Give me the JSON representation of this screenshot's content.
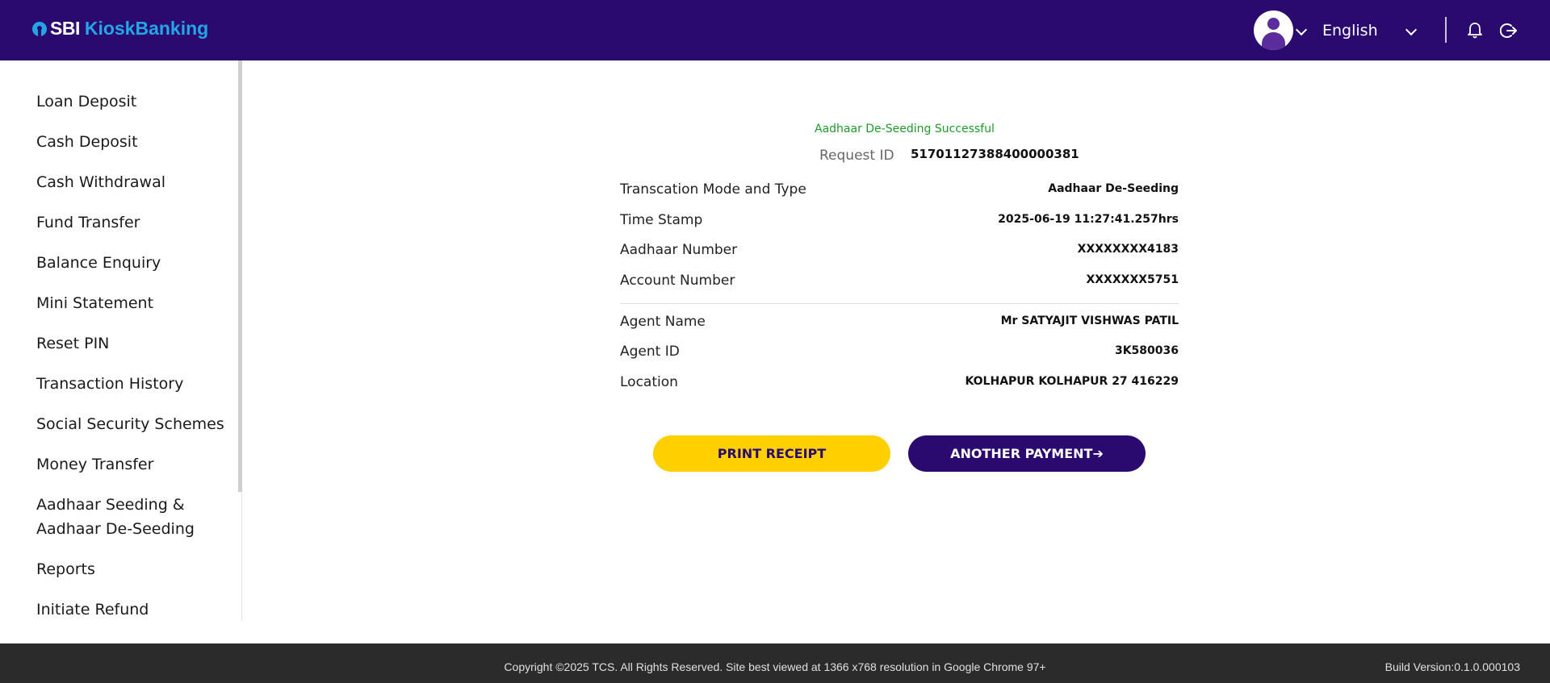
{
  "header": {
    "brand_sbi": "SBI",
    "brand_kiosk": "KioskBanking",
    "language": "English"
  },
  "sidebar": {
    "items": [
      {
        "label": "Loan Deposit"
      },
      {
        "label": "Cash Deposit"
      },
      {
        "label": "Cash Withdrawal"
      },
      {
        "label": "Fund Transfer"
      },
      {
        "label": "Balance Enquiry"
      },
      {
        "label": "Mini Statement"
      },
      {
        "label": "Reset PIN"
      },
      {
        "label": "Transaction History"
      },
      {
        "label": "Social Security Schemes"
      },
      {
        "label": "Money Transfer"
      },
      {
        "label": "Aadhaar Seeding &",
        "label2": "Aadhaar De-Seeding"
      },
      {
        "label": "Reports"
      },
      {
        "label": "Initiate Refund"
      }
    ]
  },
  "receipt": {
    "status": "Aadhaar De-Seeding Successful",
    "request_id_label": "Request ID",
    "request_id_value": "51701127388400000381",
    "rows": [
      {
        "label": "Transcation Mode and Type",
        "value": "Aadhaar De-Seeding"
      },
      {
        "label": "Time Stamp",
        "value": "2025-06-19 11:27:41.257hrs"
      },
      {
        "label": "Aadhaar Number",
        "value": "XXXXXXXX4183"
      },
      {
        "label": "Account Number",
        "value": "XXXXXXX5751"
      },
      {
        "label": "Agent Name",
        "value": "Mr SATYAJIT VISHWAS PATIL"
      },
      {
        "label": "Agent ID",
        "value": "3K580036"
      },
      {
        "label": "Location",
        "value": "KOLHAPUR KOLHAPUR 27 416229"
      }
    ]
  },
  "buttons": {
    "print": "PRINT RECEIPT",
    "another": "ANOTHER PAYMENT➔"
  },
  "footer": {
    "copyright": "Copyright ©2025 TCS. All Rights Reserved. Site best viewed at 1366 x768 resolution in Google Chrome 97+",
    "build": "Build Version:0.1.0.000103"
  },
  "colors": {
    "header_bg": "#2a0a6e",
    "brand_accent": "#22a6e6",
    "success": "#1f9a2b",
    "print_button": "#ffd000",
    "footer_bg": "#2b2b2b"
  },
  "icons": [
    "sbi-logo-icon",
    "user-avatar-icon",
    "chevron-down-icon",
    "bell-icon",
    "logout-icon"
  ]
}
